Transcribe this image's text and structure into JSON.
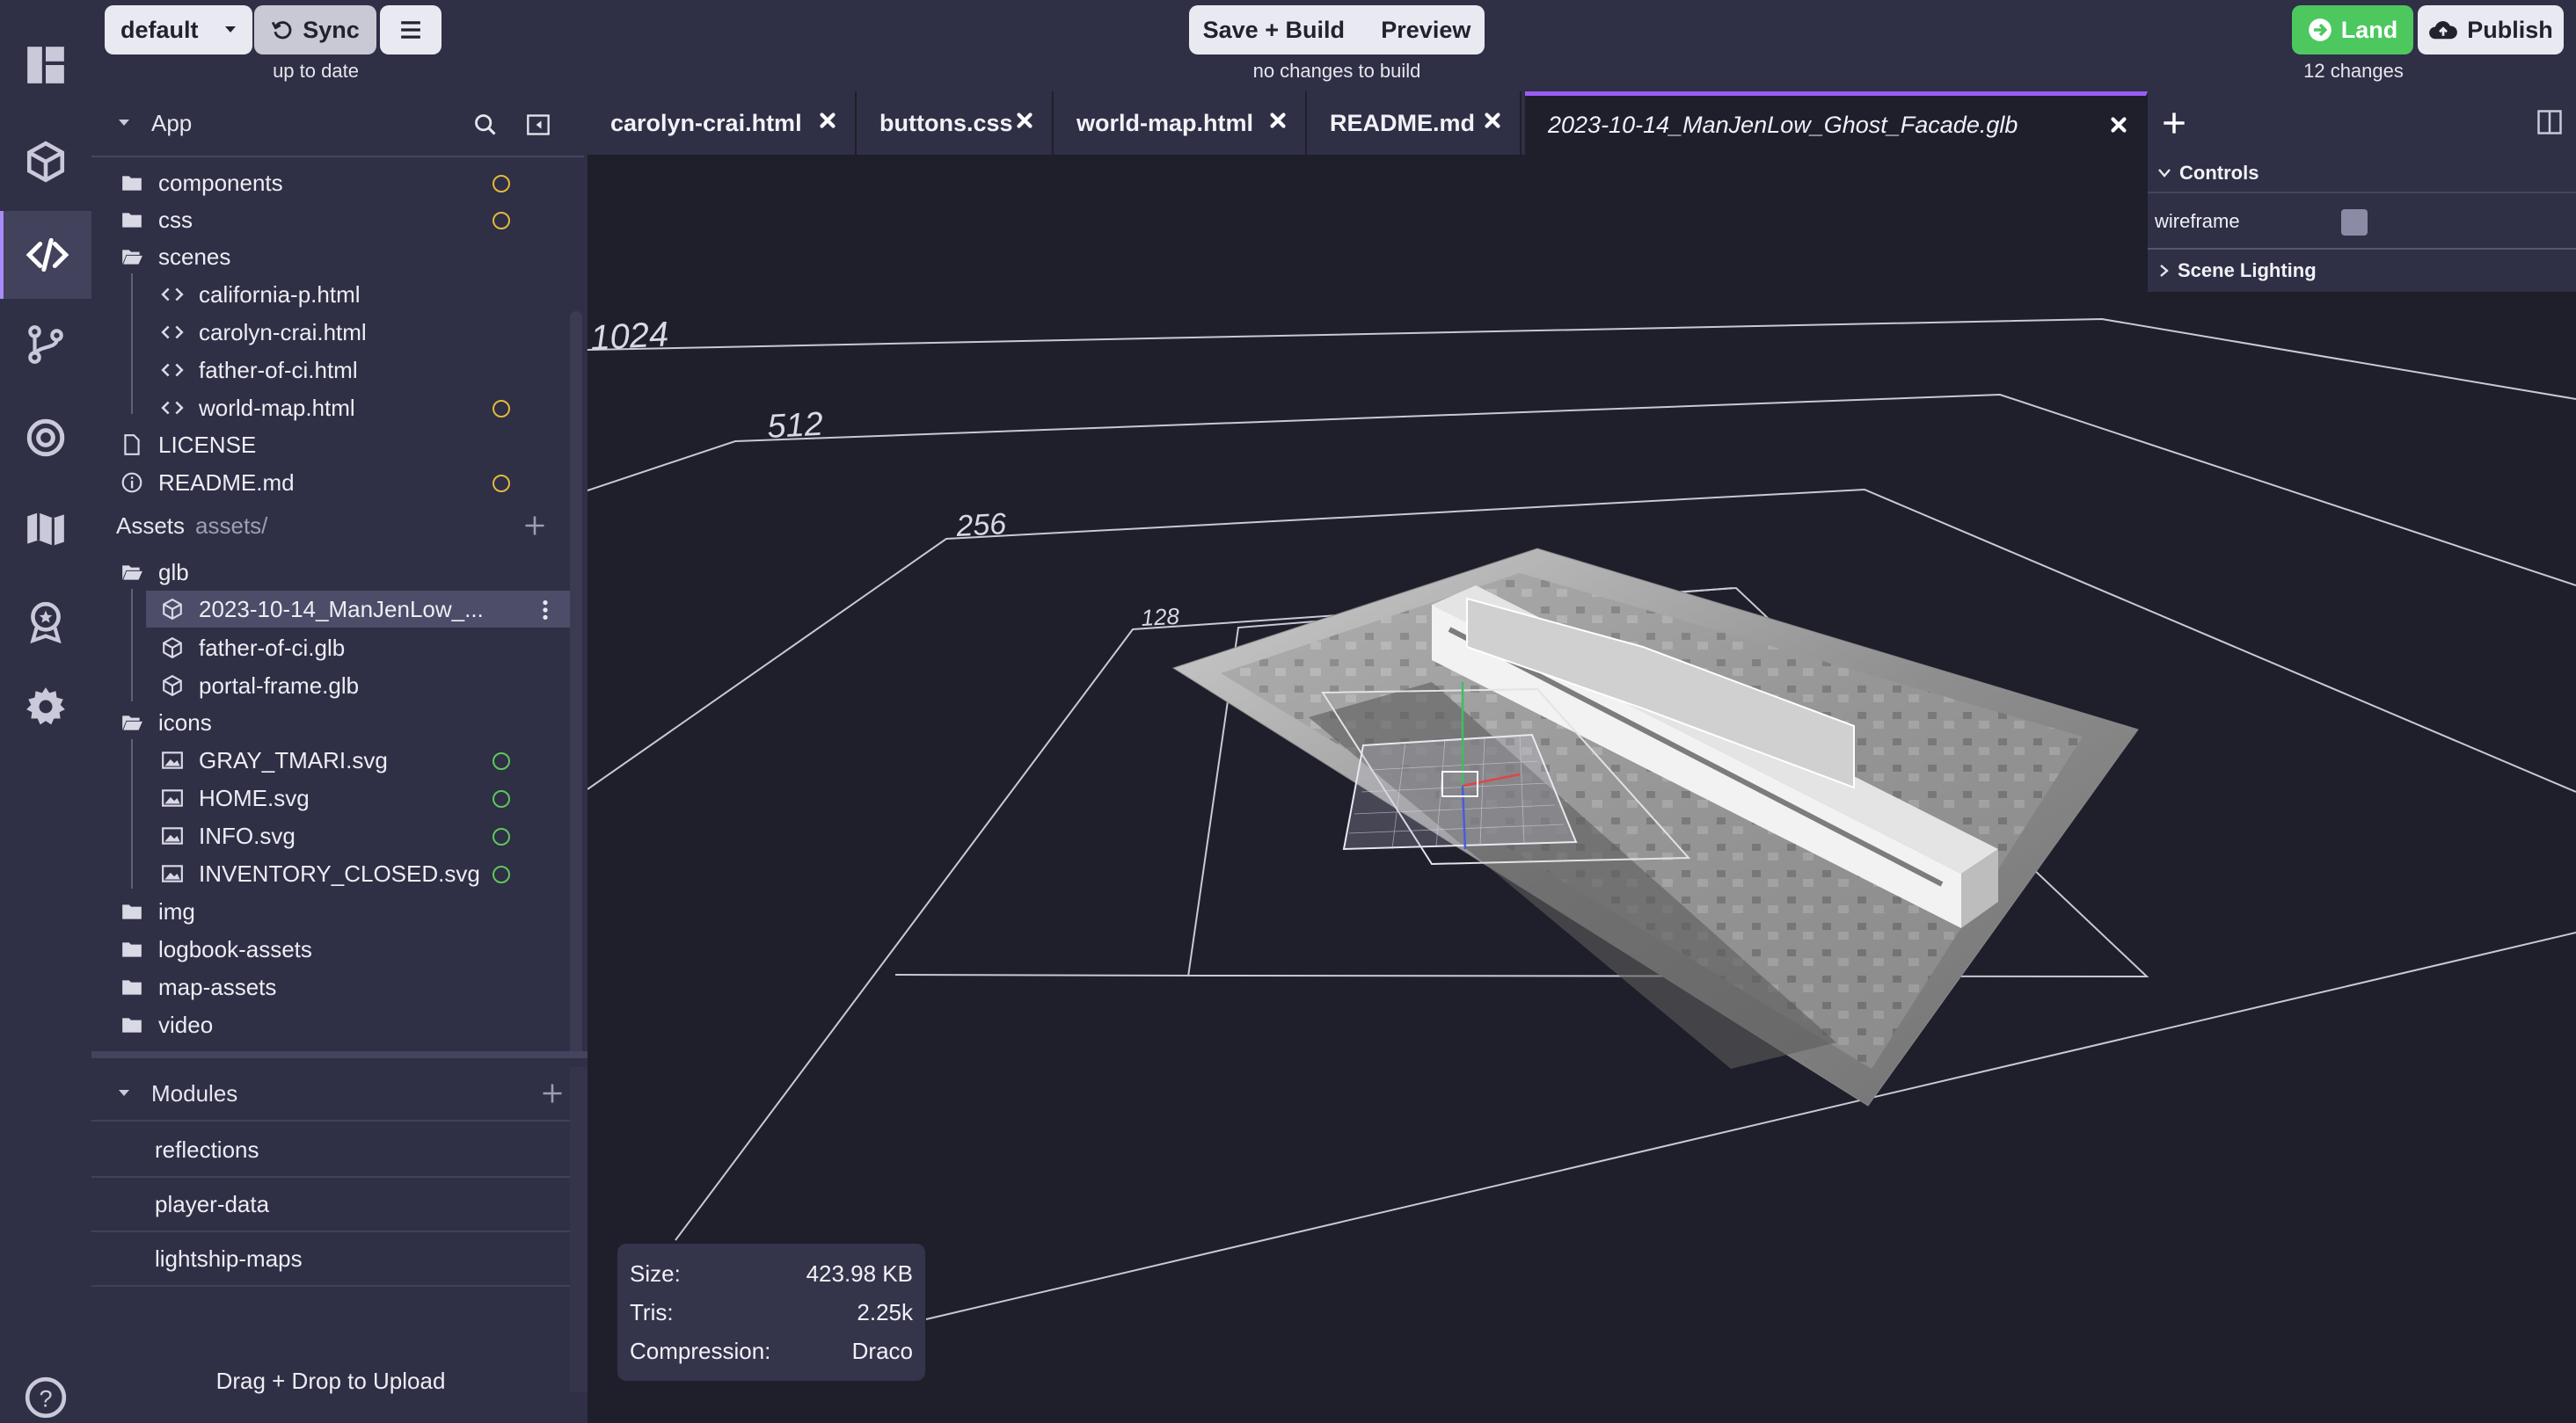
{
  "topbar": {
    "branch_select": "default",
    "sync_label": "Sync",
    "sync_status": "up to date",
    "save_build_label": "Save + Build",
    "preview_label": "Preview",
    "build_status": "no changes to build",
    "land_label": "Land",
    "publish_label": "Publish",
    "changes_count": "12 changes"
  },
  "sidebar": {
    "app_section": "App",
    "files": [
      {
        "label": "components",
        "kind": "folder",
        "dot": "yellow"
      },
      {
        "label": "css",
        "kind": "folder",
        "dot": "yellow"
      },
      {
        "label": "scenes",
        "kind": "folder-open",
        "dot": ""
      },
      {
        "label": "california-p.html",
        "kind": "code",
        "dot": ""
      },
      {
        "label": "carolyn-crai.html",
        "kind": "code",
        "dot": ""
      },
      {
        "label": "father-of-ci.html",
        "kind": "code",
        "dot": ""
      },
      {
        "label": "world-map.html",
        "kind": "code",
        "dot": "yellow"
      },
      {
        "label": "LICENSE",
        "kind": "file",
        "dot": ""
      },
      {
        "label": "README.md",
        "kind": "info",
        "dot": "yellow"
      }
    ],
    "assets_label": "Assets",
    "assets_path": "assets/",
    "assets": [
      {
        "label": "glb",
        "kind": "folder-open",
        "dot": ""
      },
      {
        "label": "2023-10-14_ManJenLow_...",
        "kind": "cube",
        "dot": "",
        "selected": true
      },
      {
        "label": "father-of-ci.glb",
        "kind": "cube",
        "dot": ""
      },
      {
        "label": "portal-frame.glb",
        "kind": "cube",
        "dot": ""
      },
      {
        "label": "icons",
        "kind": "folder-open",
        "dot": ""
      },
      {
        "label": "GRAY_TMARI.svg",
        "kind": "image",
        "dot": "green"
      },
      {
        "label": "HOME.svg",
        "kind": "image",
        "dot": "green"
      },
      {
        "label": "INFO.svg",
        "kind": "image",
        "dot": "green"
      },
      {
        "label": "INVENTORY_CLOSED.svg",
        "kind": "image",
        "dot": "green"
      },
      {
        "label": "img",
        "kind": "folder",
        "dot": ""
      },
      {
        "label": "logbook-assets",
        "kind": "folder",
        "dot": ""
      },
      {
        "label": "map-assets",
        "kind": "folder",
        "dot": ""
      },
      {
        "label": "video",
        "kind": "folder",
        "dot": ""
      }
    ],
    "modules_label": "Modules",
    "modules": [
      "reflections",
      "player-data",
      "lightship-maps"
    ],
    "upload_label": "Drag + Drop to Upload"
  },
  "tabs": [
    {
      "label": "carolyn-crai.html"
    },
    {
      "label": "buttons.css"
    },
    {
      "label": "world-map.html"
    },
    {
      "label": "README.md"
    },
    {
      "label": "2023-10-14_ManJenLow_Ghost_Facade.glb",
      "active": true
    }
  ],
  "viewer": {
    "controls_title": "Controls",
    "wireframe_label": "wireframe",
    "scene_lighting_label": "Scene Lighting",
    "grid_labels": [
      "1024",
      "512",
      "256",
      "128"
    ],
    "stats": {
      "size_label": "Size:",
      "size_value": "423.98 KB",
      "tris_label": "Tris:",
      "tris_value": "2.25k",
      "compression_label": "Compression:",
      "compression_value": "Draco"
    }
  },
  "colors": {
    "accent": "#9b5cf6",
    "land_green": "#4cc85f",
    "modified_dot": "#e2b93b",
    "added_dot": "#5cc85c"
  }
}
